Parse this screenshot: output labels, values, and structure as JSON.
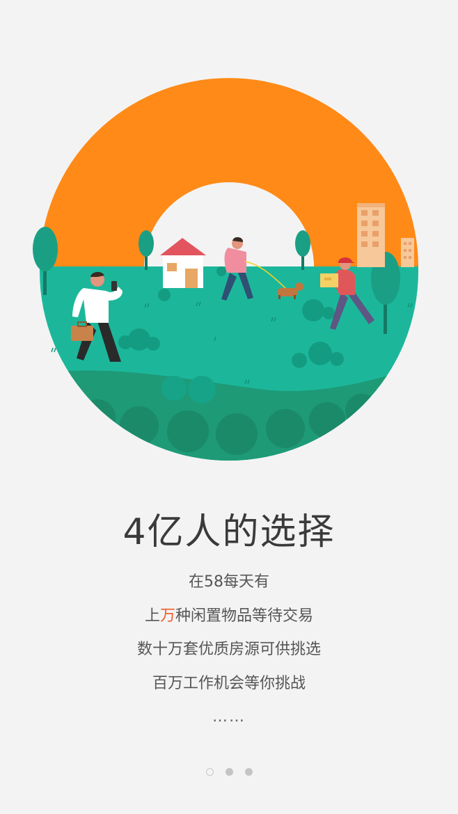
{
  "intro": {
    "headline": "4亿人的选择",
    "lines": {
      "l1": "在58每天有",
      "l2_pre": "上",
      "l2_hl": "万",
      "l2_post": "种闲置物品等待交易",
      "l3": "数十万套优质房源可供挑选",
      "l4": "百万工作机会等你挑战",
      "ellipsis": "……"
    }
  },
  "pager": {
    "count": 3,
    "active_index": 0
  },
  "colors": {
    "sun": "#ff8a17",
    "grass": "#1cb79b",
    "grass_dark": "#1e9a77",
    "highlight": "#ee5b2c",
    "background": "#f3f3f3"
  }
}
